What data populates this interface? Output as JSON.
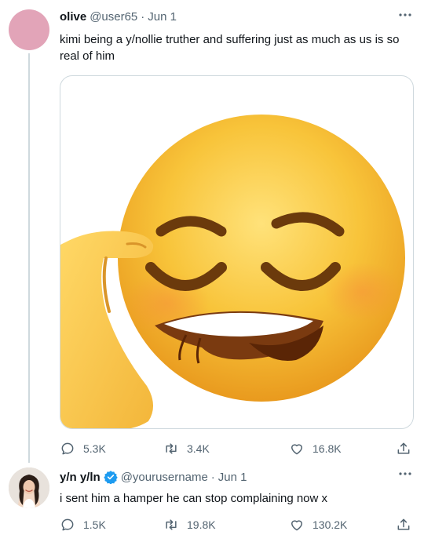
{
  "tweets": [
    {
      "display_name": "olive",
      "handle": "@user65",
      "separator": "·",
      "date": "Jun 1",
      "text": "kimi being a y/nollie truther and suffering just as much as us is so real of him",
      "media": {
        "icon": "emoji-eye-rub-smirk"
      },
      "actions": {
        "replies": "5.3K",
        "retweets": "3.4K",
        "likes": "16.8K"
      }
    },
    {
      "display_name": "y/n y/ln",
      "handle": "@yourusername",
      "separator": "·",
      "date": "Jun 1",
      "verified": true,
      "text": "i sent him a hamper he can stop complaining now x",
      "actions": {
        "replies": "1.5K",
        "retweets": "19.8K",
        "likes": "130.2K"
      }
    }
  ],
  "colors": {
    "muted": "#536471",
    "verified": "#1d9bf0",
    "thread_line": "#cfd9de"
  }
}
